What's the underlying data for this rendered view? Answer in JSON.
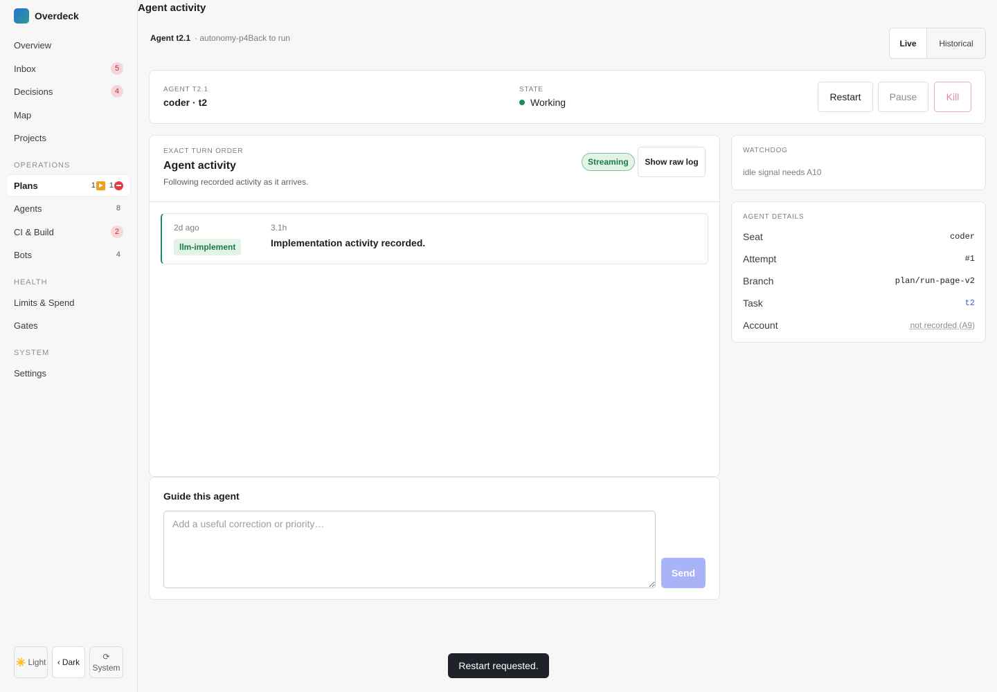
{
  "brand": {
    "name": "Overdeck"
  },
  "sidebar": {
    "primary": [
      {
        "label": "Overview",
        "count": ""
      },
      {
        "label": "Inbox",
        "count": "5"
      },
      {
        "label": "Decisions",
        "count": "4"
      },
      {
        "label": "Map",
        "count": ""
      },
      {
        "label": "Projects",
        "count": ""
      }
    ],
    "sections": {
      "operations": "OPERATIONS",
      "health": "HEALTH",
      "system": "SYSTEM"
    },
    "plans": {
      "label": "Plans",
      "running_count": "1",
      "blocked_count": "1"
    },
    "operations": [
      {
        "label": "Agents",
        "count": "8"
      },
      {
        "label": "CI & Build",
        "count": "2"
      },
      {
        "label": "Bots",
        "count": "4"
      }
    ],
    "health": [
      {
        "label": "Limits & Spend"
      },
      {
        "label": "Gates"
      }
    ],
    "system": [
      {
        "label": "Settings"
      }
    ],
    "theme": {
      "light": "Light",
      "dark": "Dark",
      "system": "System",
      "light_icon": "☀️",
      "dark_icon": "‹",
      "system_icon": "⟳",
      "selected": "Dark"
    }
  },
  "page": {
    "title": "Agent activity",
    "breadcrumb": {
      "agent": "Agent t2.1",
      "plan": "· autonomy-p4",
      "back": "Back to run"
    },
    "view_toggle": {
      "live": "Live",
      "historical": "Historical",
      "selected": "Live"
    }
  },
  "header_card": {
    "agent_label": "AGENT T2.1",
    "agent_value": "coder · t2",
    "state_label": "STATE",
    "state_value": "Working",
    "state_color": "#1e8a55",
    "buttons": {
      "restart": "Restart",
      "pause": "Pause",
      "kill": "Kill"
    }
  },
  "activity": {
    "eyebrow": "EXACT TURN ORDER",
    "title": "Agent activity",
    "subtitle": "Following recorded activity as it arrives.",
    "status_badge": "Streaming",
    "raw_log_button": "Show raw log",
    "entries": [
      {
        "age": "2d ago",
        "duration": "3.1h",
        "tag": "llm-implement",
        "message": "Implementation activity recorded."
      }
    ]
  },
  "guide": {
    "title": "Guide this agent",
    "placeholder": "Add a useful correction or priority…",
    "value": "",
    "send": "Send"
  },
  "watchdog": {
    "label": "WATCHDOG",
    "text": "idle signal needs A10"
  },
  "details": {
    "label": "AGENT DETAILS",
    "rows": [
      {
        "key": "Seat",
        "value": "coder"
      },
      {
        "key": "Attempt",
        "value": "#1"
      },
      {
        "key": "Branch",
        "value": "plan/run-page-v2"
      },
      {
        "key": "Task",
        "value": "t2"
      },
      {
        "key": "Account",
        "value": "not recorded (A9)"
      }
    ]
  },
  "toast": {
    "message": "Restart requested."
  },
  "colors": {
    "accent": "#3a5bd9",
    "success": "#1e8a55",
    "danger": "#e08a98",
    "send_disabled": "#a9b3f7"
  }
}
